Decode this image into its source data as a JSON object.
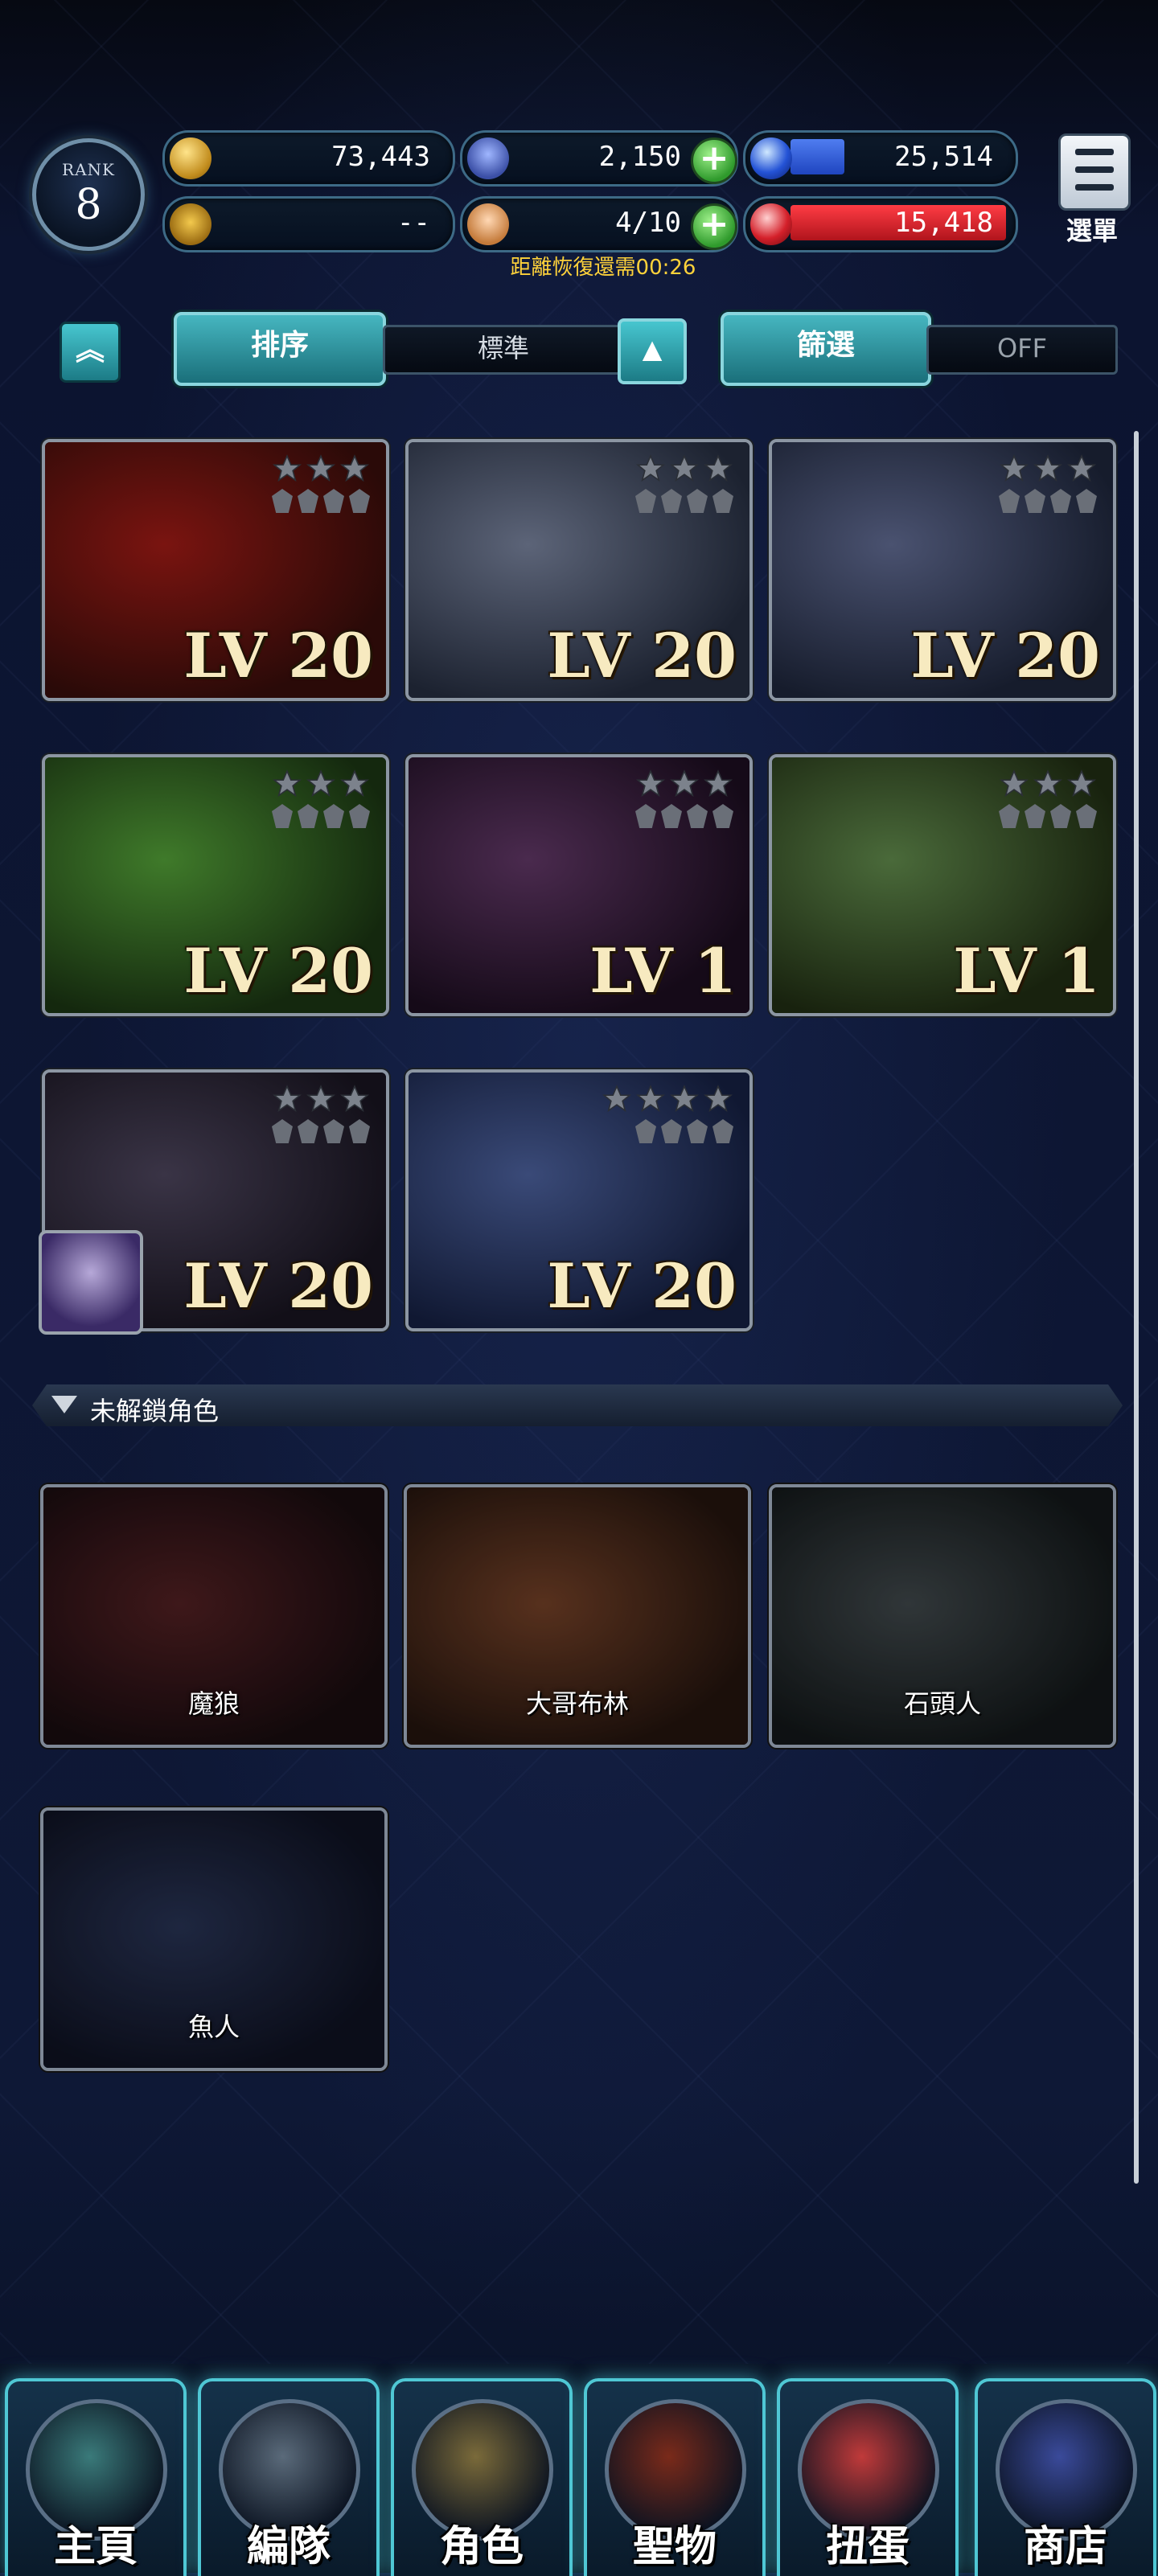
{
  "hud": {
    "rank_label": "RANK",
    "rank_value": "8",
    "gold": "73,443",
    "trophy": "--",
    "crystals": "2,150",
    "gems": "4/10",
    "blue_value": "25,514",
    "blue_fill_fraction": 0.25,
    "red_value": "15,418",
    "red_fill_fraction": 1.0,
    "recovery_text": "距離恢復還需00:26",
    "menu_label": "選單"
  },
  "sort_filter": {
    "sort_label": "排序",
    "sort_value": "標準",
    "filter_label": "篩選",
    "filter_value": "OFF"
  },
  "unlocked_cards": [
    {
      "level": "LV 20",
      "stars": 3,
      "gems": 4,
      "colors": [
        "#7a1410",
        "#2a0a08"
      ]
    },
    {
      "level": "LV 20",
      "stars": 3,
      "gems": 4,
      "colors": [
        "#5c6478",
        "#1c2230"
      ]
    },
    {
      "level": "LV 20",
      "stars": 3,
      "gems": 4,
      "colors": [
        "#4a5270",
        "#161c2c"
      ]
    },
    {
      "level": "LV 20",
      "stars": 3,
      "gems": 4,
      "colors": [
        "#3f7a2a",
        "#14280e"
      ]
    },
    {
      "level": "LV 1",
      "stars": 3,
      "gems": 4,
      "colors": [
        "#4a2a4e",
        "#150a18"
      ]
    },
    {
      "level": "LV 1",
      "stars": 3,
      "gems": 4,
      "colors": [
        "#4a6a3a",
        "#18220e"
      ]
    },
    {
      "level": "LV 20",
      "stars": 3,
      "gems": 4,
      "colors": [
        "#3a3446",
        "#120f18"
      ]
    },
    {
      "level": "LV 20",
      "stars": 4,
      "gems": 4,
      "colors": [
        "#3a4a78",
        "#101832"
      ]
    }
  ],
  "locked_section": {
    "title": "未解鎖角色",
    "cards": [
      {
        "name": "魔狼",
        "colors": [
          "#5a1a1e",
          "#1a0a0e"
        ]
      },
      {
        "name": "大哥布林",
        "colors": [
          "#7a3a1a",
          "#26120a"
        ]
      },
      {
        "name": "石頭人",
        "colors": [
          "#3a4448",
          "#101618"
        ]
      },
      {
        "name": "魚人",
        "colors": [
          "#22305a",
          "#0c1024"
        ]
      }
    ]
  },
  "nav": [
    {
      "label": "主頁",
      "icon": "home-icon",
      "color": "#3a7a7a"
    },
    {
      "label": "編隊",
      "icon": "party-icon",
      "color": "#5a6a7a"
    },
    {
      "label": "角色",
      "icon": "character-icon",
      "color": "#7a6a3a"
    },
    {
      "label": "聖物",
      "icon": "relic-icon",
      "color": "#7a2a1a"
    },
    {
      "label": "扭蛋",
      "icon": "gacha-icon",
      "color": "#c03a3a"
    },
    {
      "label": "商店",
      "icon": "shop-icon",
      "color": "#3a4a9a"
    }
  ]
}
